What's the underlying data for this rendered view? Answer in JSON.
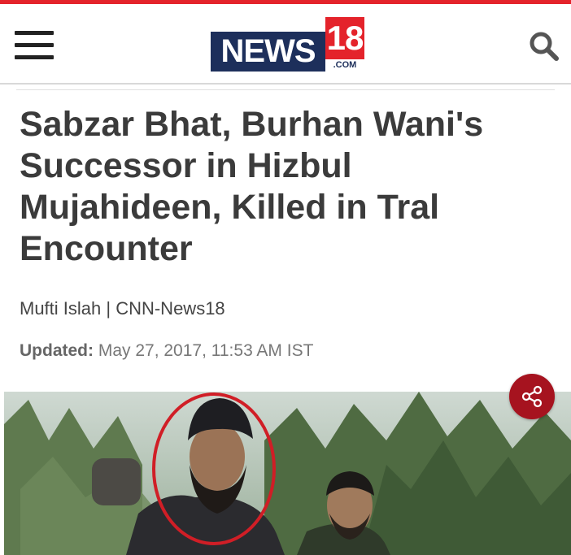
{
  "header": {
    "logo_news": "NEWS",
    "logo_18": "18",
    "logo_com": ".COM",
    "menu_icon": "hamburger-menu-icon",
    "search_icon": "search-icon"
  },
  "article": {
    "headline": "Sabzar Bhat, Burhan Wani's Successor in Hizbul Mujahideen, Killed in Tral Encounter",
    "byline": "Mufti Islah | CNN-News18",
    "updated_label": "Updated:",
    "updated_value": " May 27, 2017, 11:53 AM IST"
  },
  "share": {
    "icon": "share-icon"
  },
  "colors": {
    "brand_red": "#e4232b",
    "brand_navy": "#1d2f5b",
    "share_bg": "#a6131f",
    "headline": "#3b3b3b"
  }
}
